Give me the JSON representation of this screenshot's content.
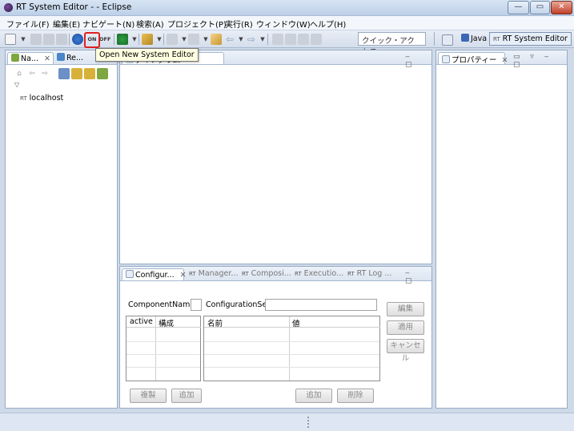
{
  "window": {
    "title": "RT System Editor -  - Eclipse",
    "controls": {
      "minimize": "—",
      "maximize": "▭",
      "close": "✕"
    }
  },
  "menu": [
    "ファイル(F)",
    "編集(E)",
    "ナビゲート(N)",
    "検索(A)",
    "プロジェクト(P)",
    "実行(R)",
    "ウィンドウ(W)",
    "ヘルプ(H)"
  ],
  "toolbar": {
    "tooltip": "Open New System Editor",
    "on_label": "ON",
    "off_label": "OFF",
    "quick_access_placeholder": "クイック・アクセス"
  },
  "perspectives": {
    "java": "Java",
    "rt_system_editor": "RT System Editor",
    "rt_prefix": "RT"
  },
  "navigator": {
    "tabs": [
      "Na...",
      "Re..."
    ],
    "tree_root": "localhost",
    "rt_prefix": "RT"
  },
  "editor": {
    "tab_label": "ダイアグラム"
  },
  "properties": {
    "tab_label": "プロパティー"
  },
  "bottom_tabs": [
    "Configur...",
    "Manager...",
    "Composi...",
    "Executio...",
    "RT Log ..."
  ],
  "config": {
    "component_name_label": "ComponentName:",
    "configuration_set_label": "ConfigurationSet:",
    "component_name_value": "",
    "configuration_set_value": "",
    "left_table": {
      "headers": [
        "active",
        "構成"
      ]
    },
    "right_table": {
      "headers": [
        "名前",
        "値"
      ]
    },
    "buttons": {
      "edit": "編集",
      "apply": "適用",
      "cancel": "キャンセル",
      "copy": "複製",
      "add_left": "追加",
      "add_right": "追加",
      "delete": "削除"
    }
  },
  "colors": {
    "accent": "#e02020",
    "panel_border": "#99abc7",
    "frame": "#cfdae8"
  }
}
